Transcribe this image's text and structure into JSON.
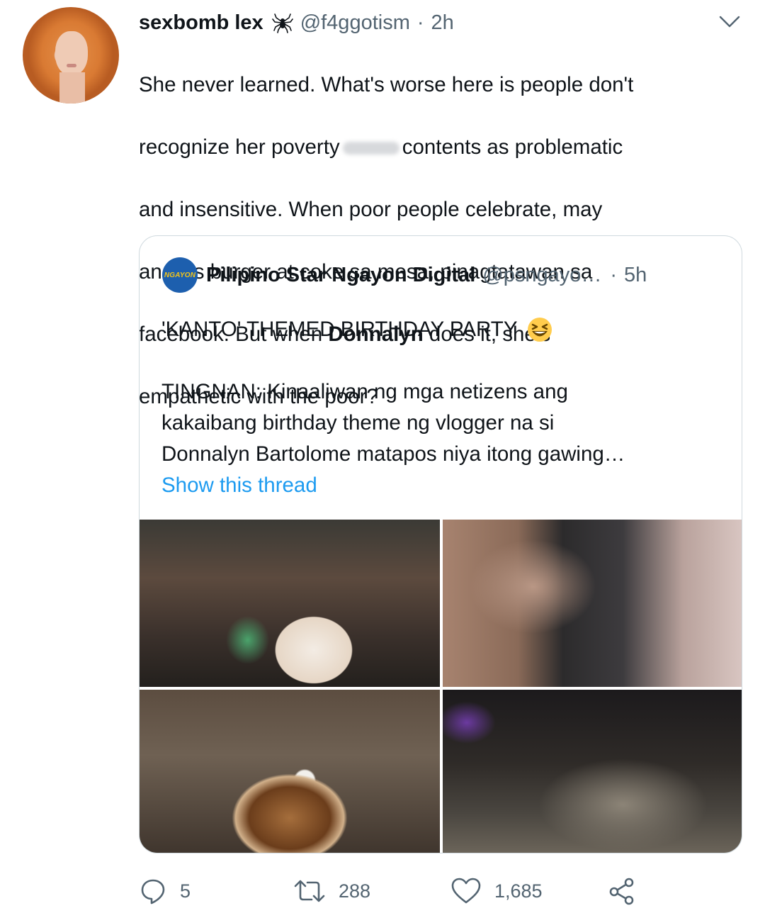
{
  "tweet": {
    "author_name": "sexbomb lex",
    "author_handle": "@f4ggotism",
    "time": "2h",
    "text_line1": "She never learned. What's worse here is people don't",
    "text_line2a": "recognize her poverty",
    "text_line2b": "contents as problematic",
    "text_line3": "and insensitive. When poor people celebrate, may",
    "text_line4": "angel's burger at coke sa mesa, pinagtatawan sa",
    "text_line5a": "facebook. But when ",
    "text_bold": "Donnalyn",
    "text_line5b": " does it, she's",
    "text_line6": "empathetic with the poor?"
  },
  "quote": {
    "author_name": "Pilipino Star Ngayon Digital",
    "author_handle": "@psngayo…",
    "time": "5h",
    "logo_text": "NGAYON",
    "title": "'KANTO' THEMED BIRTHDAY PARTY",
    "body_line1": "TINGNAN: Kinaaliwan ng mga netizens ang",
    "body_line2": "kakaibang birthday theme ng vlogger na si",
    "body_line3": "Donnalyn Bartolome matapos niya itong gawing…",
    "show_thread": "Show this thread"
  },
  "actions": {
    "replies": "5",
    "retweets": "288",
    "likes": "1,685"
  },
  "colors": {
    "text": "#0f1419",
    "secondary": "#536471",
    "link": "#1d9bf0",
    "border": "#cfd9de"
  }
}
